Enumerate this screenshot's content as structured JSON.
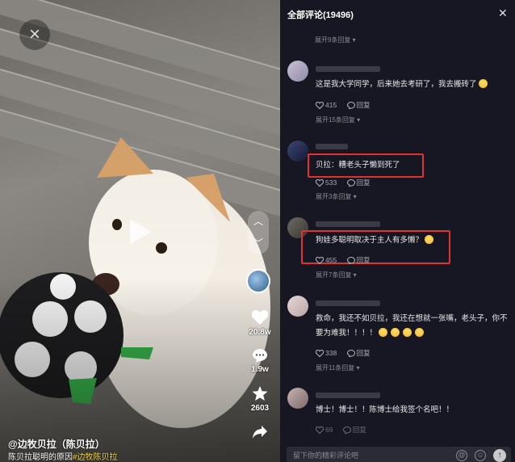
{
  "video": {
    "like_count": "20.8w",
    "comment_count": "1.9w",
    "favorite_count": "2603",
    "author": "@边牧贝拉（陈贝拉）",
    "caption": "陈贝拉聪明的原因",
    "hashtag": "#边牧陈贝拉"
  },
  "comments_panel": {
    "title": "全部评论(19496)",
    "top_expand": "展开9条回复",
    "input_placeholder": "留下你的精彩评论吧",
    "items": [
      {
        "text": "这是我大学同学，后来她去考研了，我去搬砖了",
        "emoji_count": 1,
        "likes": "415",
        "reply_label": "回复",
        "expand": "展开15条回复",
        "highlighted": false
      },
      {
        "text": "贝拉：糟老头子懒到死了",
        "emoji_count": 0,
        "likes": "533",
        "reply_label": "回复",
        "expand": "展开3条回复",
        "highlighted": true
      },
      {
        "text": "狗娃多聪明取决于主人有多懒？",
        "emoji_count": 1,
        "likes": "455",
        "reply_label": "回复",
        "expand": "展开7条回复",
        "highlighted": true
      },
      {
        "text": "救命，我还不如贝拉，我还在想就一张嘴，老头子，你不要为难我！！！！",
        "emoji_count": 4,
        "likes": "338",
        "reply_label": "回复",
        "expand": "展开11条回复",
        "highlighted": false
      },
      {
        "text": "博士！博士！！陈博士给我签个名吧！！",
        "emoji_count": 0,
        "likes": "69",
        "reply_label": "回复",
        "expand": "",
        "highlighted": false
      }
    ]
  },
  "colors": {
    "panel_bg": "#161722",
    "highlight_box": "#e0322e",
    "hashtag": "#f5d94a"
  },
  "icons": [
    "close-icon",
    "play-icon",
    "chevron-up-icon",
    "chevron-down-icon",
    "heart-icon",
    "comment-icon",
    "star-icon",
    "share-icon",
    "at-icon",
    "emoji-icon",
    "send-icon"
  ]
}
